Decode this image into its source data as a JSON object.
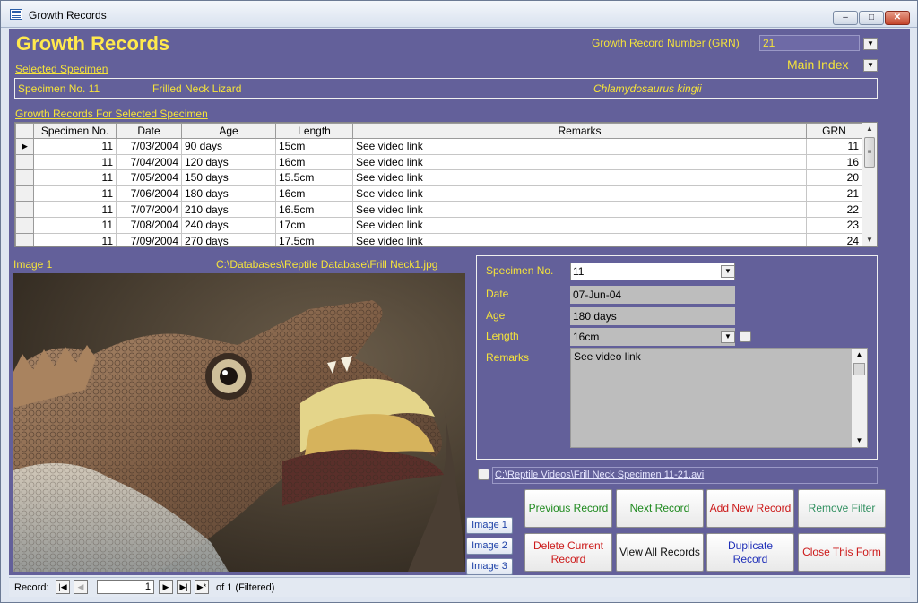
{
  "window": {
    "title": "Growth Records",
    "min": "–",
    "max": "□",
    "close": "✕"
  },
  "header": {
    "title": "Growth Records",
    "grn_label": "Growth Record Number (GRN)",
    "grn_value": "21",
    "main_index": "Main Index"
  },
  "selected_specimen": {
    "heading": "Selected Specimen",
    "number": "Specimen No. 11",
    "common_name": "Frilled Neck Lizard",
    "scientific_name": "Chlamydosaurus kingii"
  },
  "records": {
    "heading": "Growth Records For Selected Specimen",
    "columns": [
      "Specimen No.",
      "Date",
      "Age",
      "Length",
      "Remarks",
      "GRN"
    ],
    "rows": [
      [
        "11",
        "7/03/2004",
        "90 days",
        "15cm",
        "See video link",
        "11"
      ],
      [
        "11",
        "7/04/2004",
        "120 days",
        "16cm",
        "See video link",
        "16"
      ],
      [
        "11",
        "7/05/2004",
        "150 days",
        "15.5cm",
        "See video link",
        "20"
      ],
      [
        "11",
        "7/06/2004",
        "180 days",
        "16cm",
        "See video link",
        "21"
      ],
      [
        "11",
        "7/07/2004",
        "210 days",
        "16.5cm",
        "See video link",
        "22"
      ],
      [
        "11",
        "7/08/2004",
        "240 days",
        "17cm",
        "See video link",
        "23"
      ],
      [
        "11",
        "7/09/2004",
        "270 days",
        "17.5cm",
        "See video link",
        "24"
      ]
    ]
  },
  "image": {
    "label": "Image 1",
    "path": "C:\\Databases\\Reptile Database\\Frill Neck1.jpg",
    "buttons": [
      "Image 1",
      "Image 2",
      "Image 3"
    ]
  },
  "detail": {
    "specimen_label": "Specimen No.",
    "specimen_value": "11",
    "date_label": "Date",
    "date_value": "07-Jun-04",
    "age_label": "Age",
    "age_value": "180 days",
    "length_label": "Length",
    "length_value": "16cm",
    "remarks_label": "Remarks",
    "remarks_value": "See video link"
  },
  "video": {
    "path": "C:\\Reptile Videos\\Frill Neck Specimen 11-21.avi"
  },
  "commands": {
    "previous": "Previous Record",
    "next": "Next Record",
    "add_new": "Add New Record",
    "remove_filter": "Remove Filter",
    "delete": "Delete Current Record",
    "view_all": "View All Records",
    "duplicate": "Duplicate Record",
    "close": "Close This Form"
  },
  "status": {
    "record_label": "Record:",
    "current": "1",
    "of_text": "of  1 (Filtered)"
  },
  "colors": {
    "form_bg": "#63609a",
    "label": "#f5e33a"
  }
}
